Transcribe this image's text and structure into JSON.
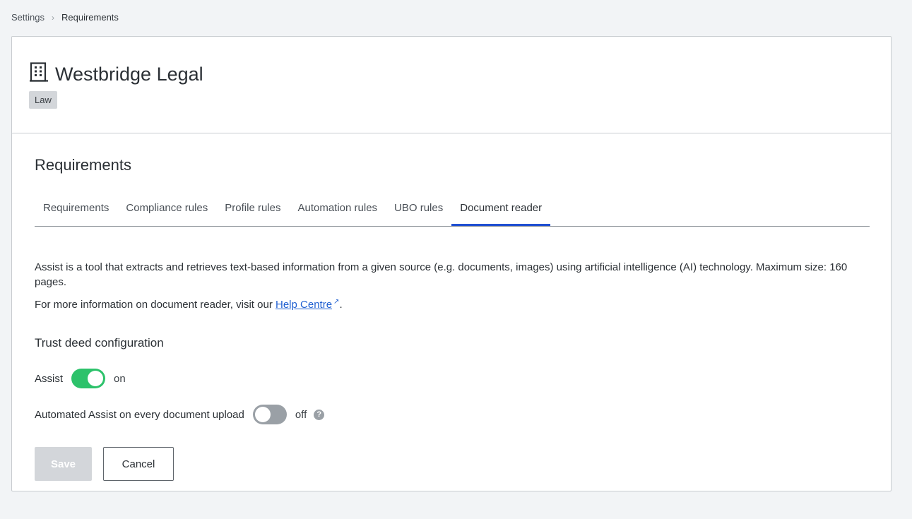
{
  "breadcrumb": {
    "settings": "Settings",
    "separator": "›",
    "current": "Requirements"
  },
  "org": {
    "icon": "building-icon",
    "name": "Westbridge Legal",
    "tag": "Law"
  },
  "section": {
    "title": "Requirements"
  },
  "tabs": [
    {
      "label": "Requirements",
      "active": false
    },
    {
      "label": "Compliance rules",
      "active": false
    },
    {
      "label": "Profile rules",
      "active": false
    },
    {
      "label": "Automation rules",
      "active": false
    },
    {
      "label": "UBO rules",
      "active": false
    },
    {
      "label": "Document reader",
      "active": true
    }
  ],
  "content": {
    "description": "Assist is a tool that extracts and retrieves text-based information from a given source (e.g. documents, images) using artificial intelligence (AI) technology. Maximum size: 160 pages.",
    "more_info_prefix": "For more information on document reader, visit our ",
    "help_link": "Help Centre",
    "more_info_suffix": ".",
    "subsection_title": "Trust deed configuration"
  },
  "toggles": {
    "assist": {
      "label": "Assist",
      "state": "on"
    },
    "automated": {
      "label": "Automated Assist on every document upload",
      "state": "off"
    }
  },
  "buttons": {
    "save": "Save",
    "cancel": "Cancel"
  },
  "colors": {
    "accent": "#1f4fd1",
    "toggle_on": "#2dc26b",
    "toggle_off": "#9aa0a6",
    "link": "#1f5fd1"
  }
}
